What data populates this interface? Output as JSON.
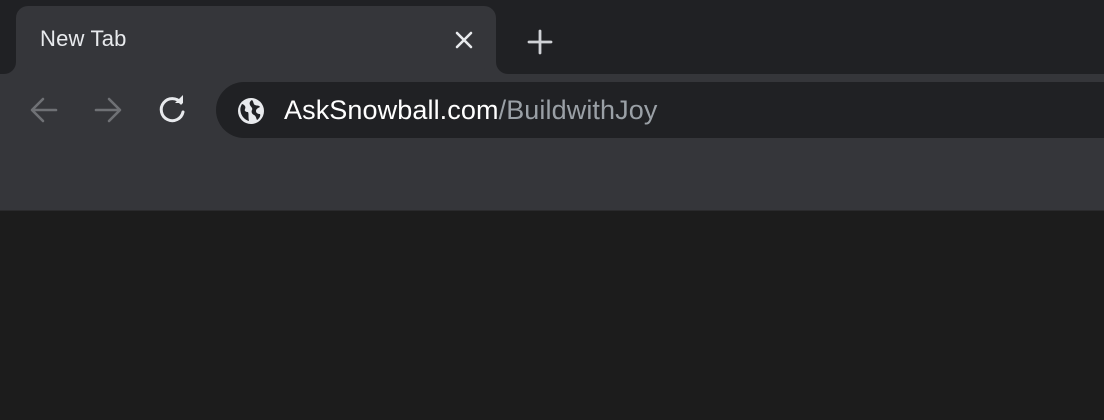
{
  "tabs": [
    {
      "title": "New Tab",
      "close_icon": "close-icon",
      "active": true
    }
  ],
  "new_tab_icon": "plus-icon",
  "toolbar": {
    "back_icon": "arrow-left-icon",
    "forward_icon": "arrow-right-icon",
    "reload_icon": "reload-icon"
  },
  "omnibox": {
    "site_icon": "globe-icon",
    "host": "AskSnowball.com",
    "path": "/BuildwithJoy"
  },
  "colors": {
    "tabstrip_bg": "#202124",
    "toolbar_bg": "#35363a",
    "omnibox_bg": "#202124",
    "content_bg": "#1c1c1c",
    "text_primary": "#e8eaed",
    "text_secondary": "#9aa0a6"
  }
}
